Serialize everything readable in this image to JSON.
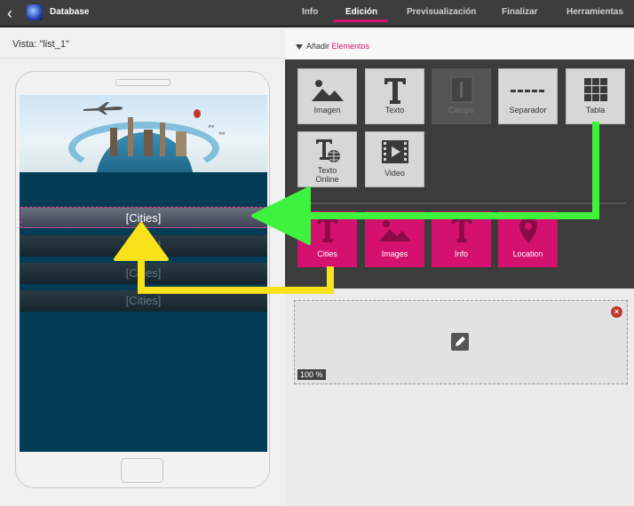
{
  "topbar": {
    "app_title": "Database",
    "tabs": [
      "Info",
      "Edición",
      "Previsualización",
      "Finalizar",
      "Herramientas"
    ],
    "active_tab": "Edición"
  },
  "left": {
    "vista_label": "Vista: \"list_1\"",
    "rows": [
      "[Cities]",
      "[Cities]",
      "[Cities]",
      "[Cities]"
    ]
  },
  "right": {
    "add_label": "Añadir",
    "add_highlight": "Elementos",
    "elements": [
      {
        "label": "Imagen",
        "icon": "image-icon"
      },
      {
        "label": "Texto",
        "icon": "text-icon"
      },
      {
        "label": "Campo",
        "icon": "field-icon"
      },
      {
        "label": "Separador",
        "icon": "separator-icon"
      },
      {
        "label": "Tabla",
        "icon": "table-icon"
      },
      {
        "label": "Texto\nOnline",
        "icon": "online-text-icon"
      },
      {
        "label": "Video",
        "icon": "video-icon"
      }
    ],
    "custom": [
      {
        "label": "Cities",
        "icon": "text-icon"
      },
      {
        "label": "Images",
        "icon": "image-icon"
      },
      {
        "label": "Info",
        "icon": "text-icon"
      },
      {
        "label": "Location",
        "icon": "location-icon"
      }
    ],
    "zoom": "100 %",
    "close_glyph": "×"
  },
  "colors": {
    "accent": "#d4116f",
    "green_arrow": "#3ef23e",
    "yellow_arrow": "#f8e21a"
  }
}
